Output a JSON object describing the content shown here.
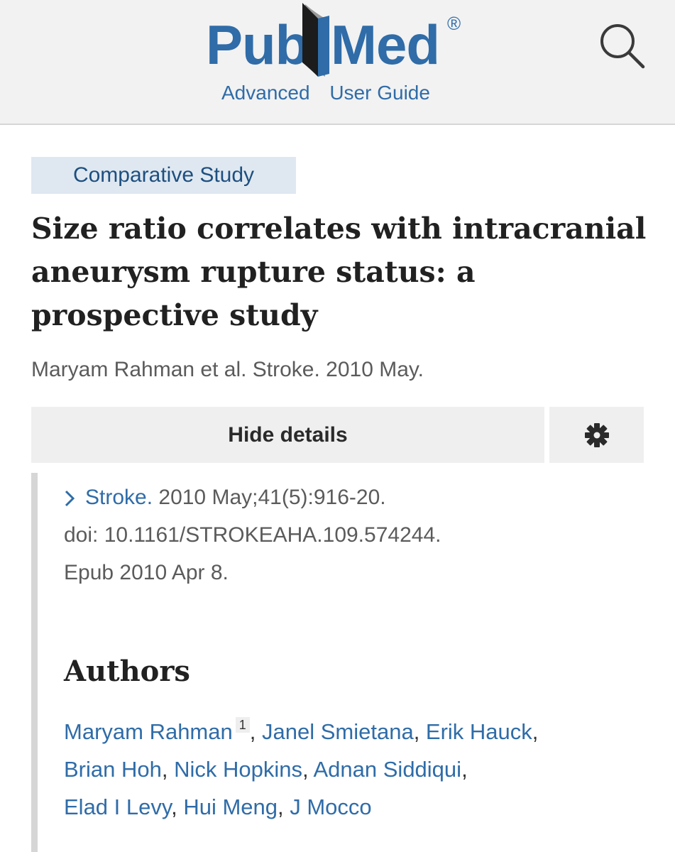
{
  "header": {
    "logo_left": "Pub",
    "logo_right": "Med",
    "logo_registered": "®",
    "links": [
      "Advanced",
      "User Guide"
    ],
    "search_icon": "search-icon",
    "brand_color": "#2f6ca8"
  },
  "article": {
    "publication_type": "Comparative Study",
    "title": "Size ratio correlates with intracranial aneurysm rupture status: a prospective study",
    "short_citation": "Maryam Rahman et al. Stroke. 2010 May.",
    "hide_details_label": "Hide details",
    "settings_icon": "gear-icon",
    "journal": "Stroke.",
    "journal_details": " 2010 May;41(5):916-20.",
    "doi": "doi: 10.1161/STROKEAHA.109.574244.",
    "epub": "Epub 2010 Apr 8."
  },
  "authors": {
    "heading": "Authors",
    "list": [
      {
        "name": "Maryam Rahman",
        "aff": "1"
      },
      {
        "name": "Janel Smietana"
      },
      {
        "name": "Erik Hauck"
      },
      {
        "name": "Brian Hoh"
      },
      {
        "name": "Nick Hopkins"
      },
      {
        "name": "Adnan Siddiqui"
      },
      {
        "name": "Elad I Levy"
      },
      {
        "name": "Hui Meng"
      },
      {
        "name": "J Mocco"
      }
    ]
  }
}
